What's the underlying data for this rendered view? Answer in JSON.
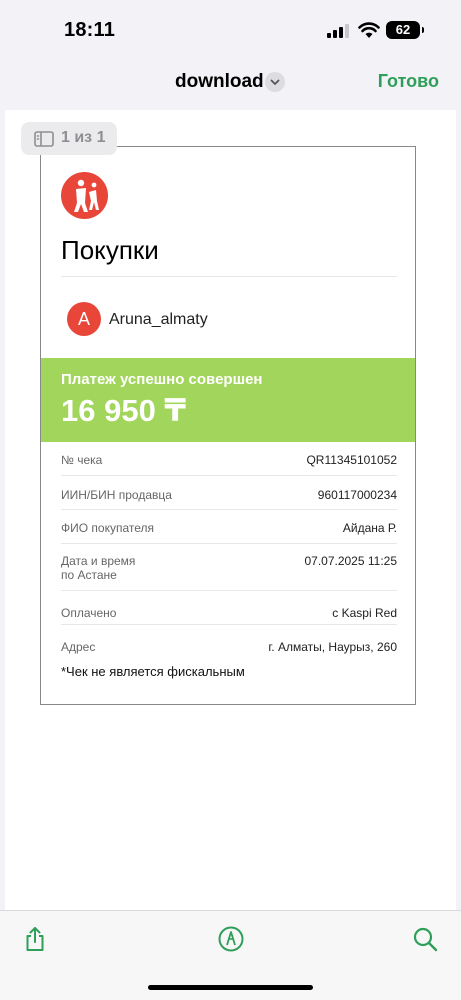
{
  "status_bar": {
    "time": "18:11",
    "battery": "62"
  },
  "nav": {
    "title": "download",
    "done_label": "Готово"
  },
  "viewer": {
    "page_indicator": "1 из 1"
  },
  "receipt": {
    "title": "Покупки",
    "seller": {
      "avatar_letter": "A",
      "name": "Aruna_almaty"
    },
    "banner": {
      "title": "Платеж успешно совершен",
      "amount": "16 950 ₸"
    },
    "rows": [
      {
        "label": "№ чека",
        "value": "QR11345101052"
      },
      {
        "label": "ИИН/БИН продавца",
        "value": "960117000234"
      },
      {
        "label": "ФИО покупателя",
        "value": "Айдана Р."
      },
      {
        "label": "Дата и время",
        "label2": "по Астане",
        "value": "07.07.2025 11:25"
      },
      {
        "label": "Оплачено",
        "value": "с Kaspi Red"
      },
      {
        "label": "Адрес",
        "value": "г. Алматы, Наурыз, 260"
      }
    ],
    "footnote": "*Чек не является фискальным"
  },
  "toolbar": {
    "icons": [
      "share-icon",
      "markup-icon",
      "search-icon"
    ]
  },
  "colors": {
    "accent": "#2e9f59",
    "banner": "#a1d55b",
    "logo": "#e9463a"
  }
}
